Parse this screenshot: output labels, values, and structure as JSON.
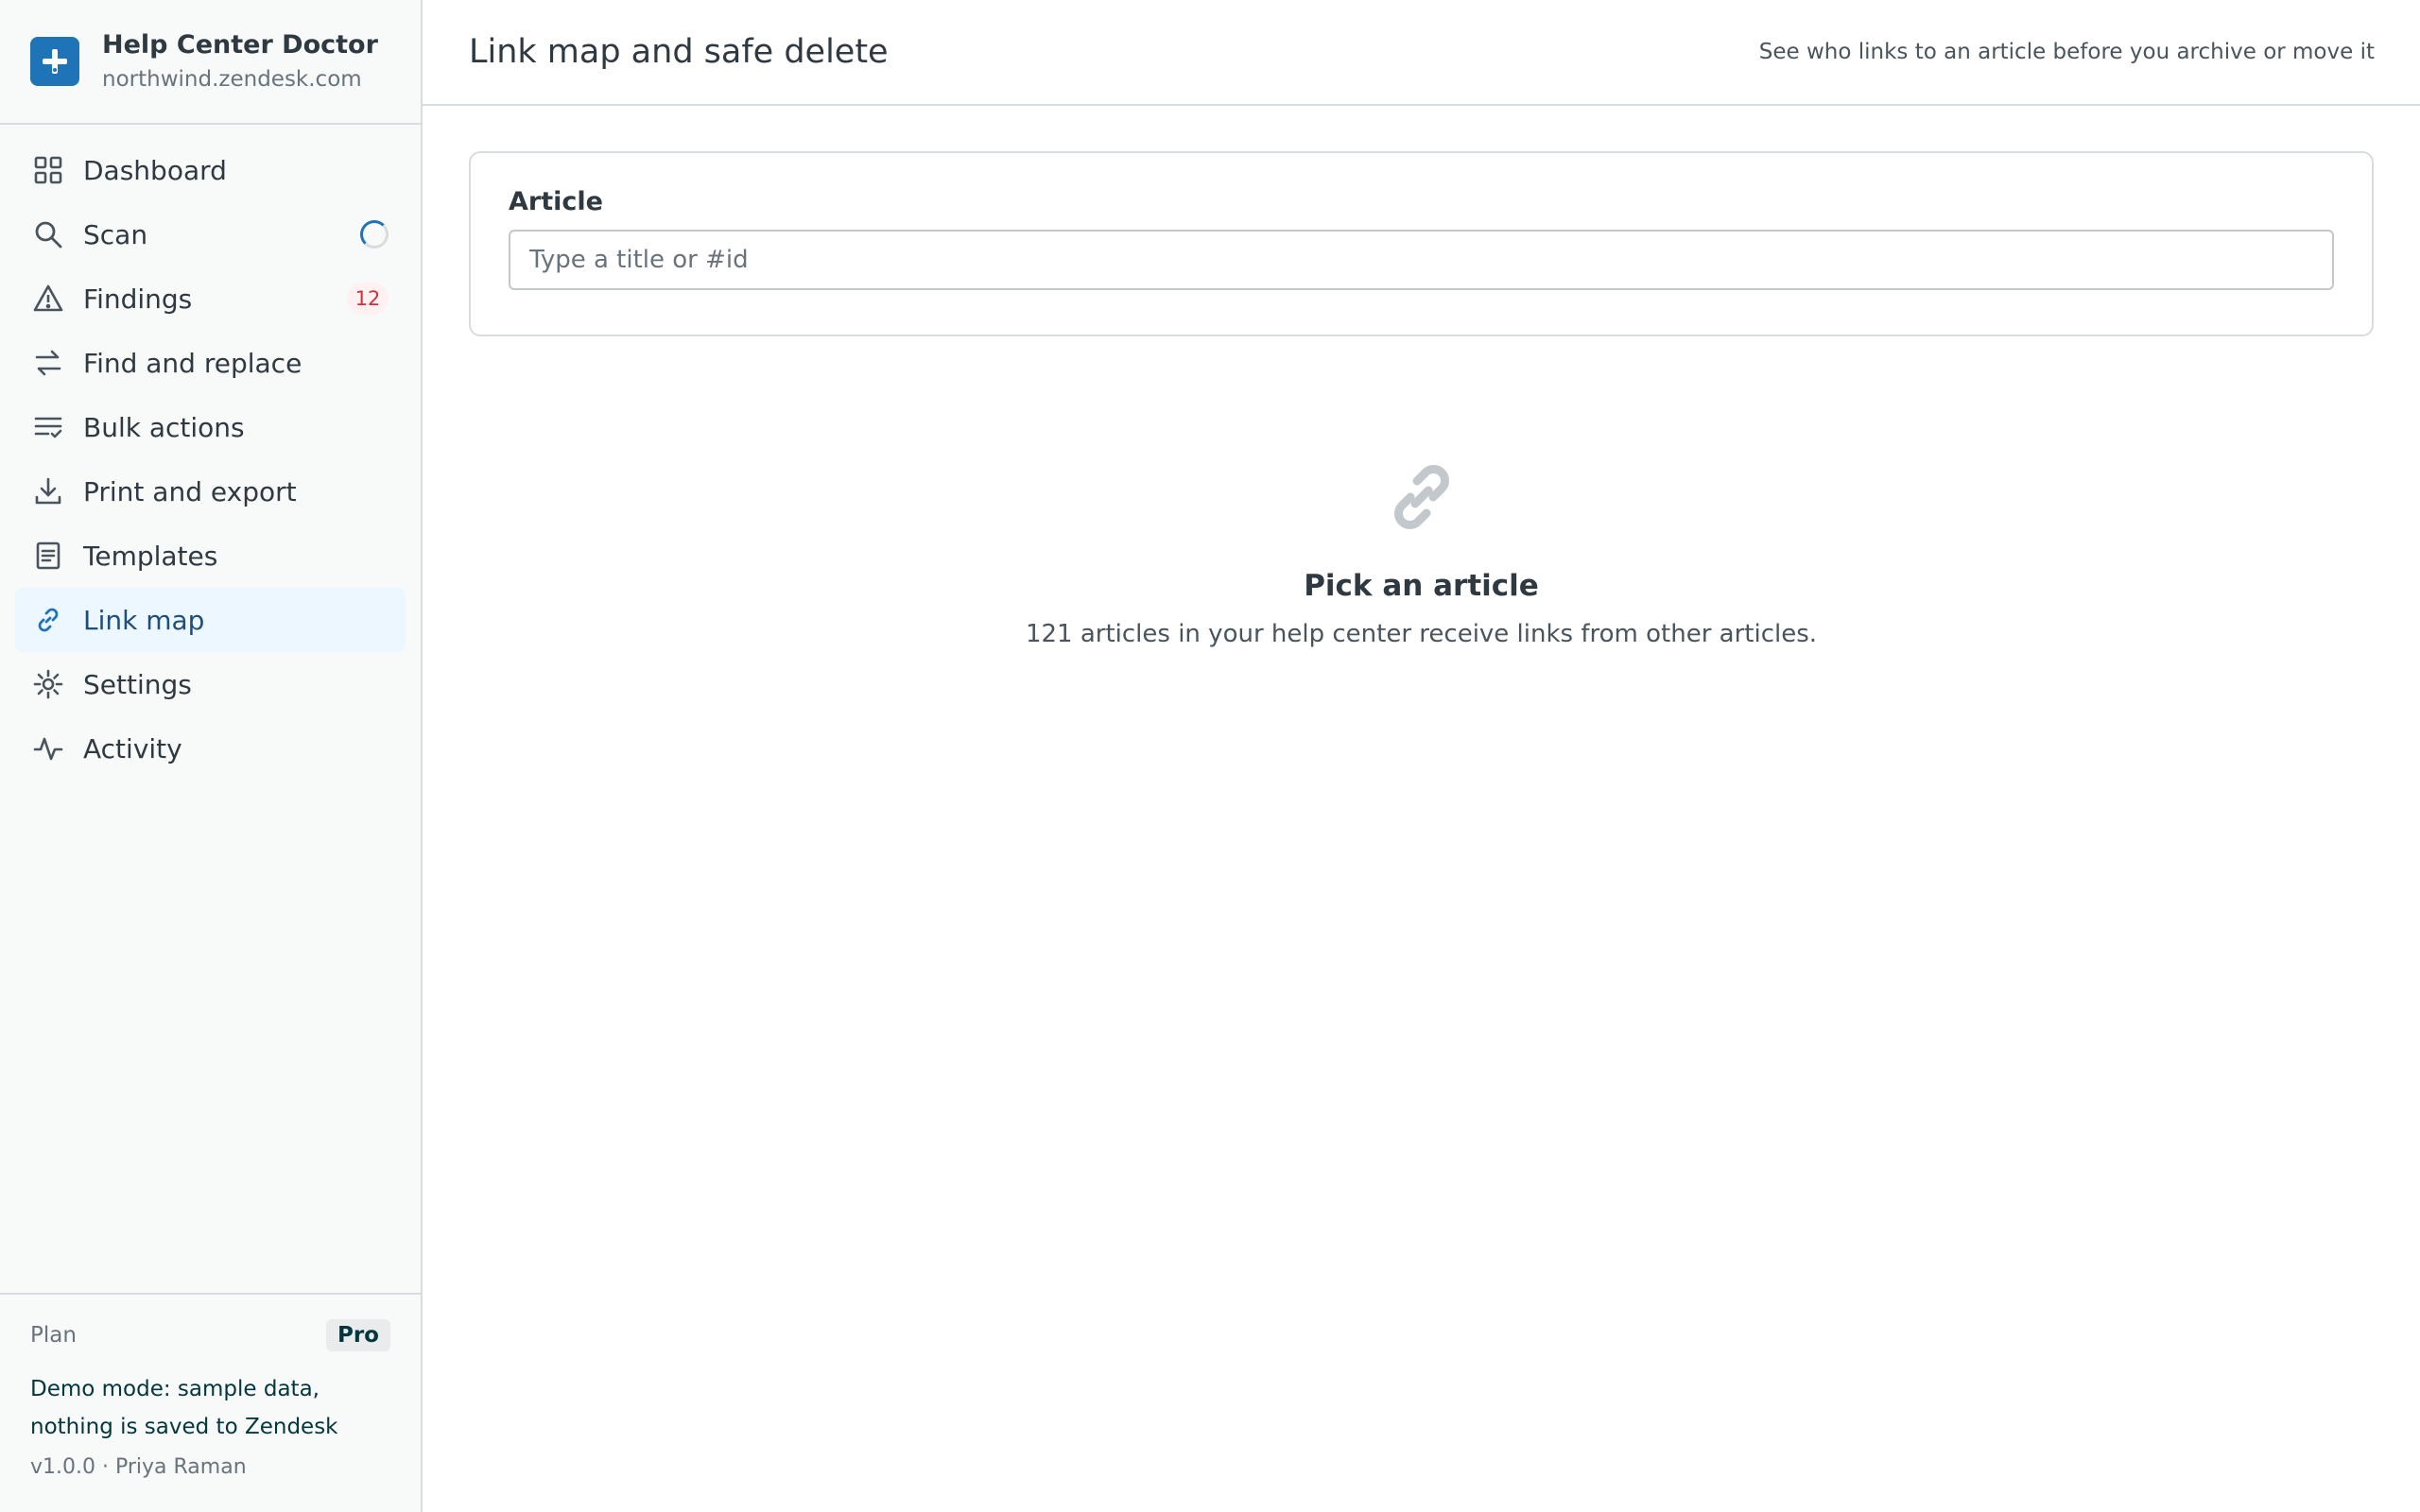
{
  "brand": {
    "name": "Help Center Doctor",
    "domain": "northwind.zendesk.com",
    "logo_icon": "plus-icon",
    "accent": "#1f73b7"
  },
  "sidebar": {
    "items": [
      {
        "label": "Dashboard",
        "icon": "grid-icon"
      },
      {
        "label": "Scan",
        "icon": "search-icon",
        "status": "loading-spinner"
      },
      {
        "label": "Findings",
        "icon": "warning-icon",
        "badge": "12"
      },
      {
        "label": "Find and replace",
        "icon": "swap-arrows-icon"
      },
      {
        "label": "Bulk actions",
        "icon": "list-check-icon"
      },
      {
        "label": "Print and export",
        "icon": "download-icon"
      },
      {
        "label": "Templates",
        "icon": "document-icon"
      },
      {
        "label": "Link map",
        "icon": "link-icon",
        "active": true
      },
      {
        "label": "Settings",
        "icon": "gear-icon"
      },
      {
        "label": "Activity",
        "icon": "activity-icon"
      }
    ],
    "footer": {
      "plan_label": "Plan",
      "plan_value": "Pro",
      "demo_note": "Demo mode: sample data, nothing is saved to Zendesk",
      "version": "v1.0.0 · Priya Raman"
    }
  },
  "header": {
    "title": "Link map and safe delete",
    "hint": "See who links to an article before you archive or move it"
  },
  "article_picker": {
    "label": "Article",
    "value": "",
    "placeholder": "Type a title or #id"
  },
  "empty_state": {
    "icon": "link-icon",
    "title": "Pick an article",
    "text": "121 articles in your help center receive links from other articles."
  }
}
